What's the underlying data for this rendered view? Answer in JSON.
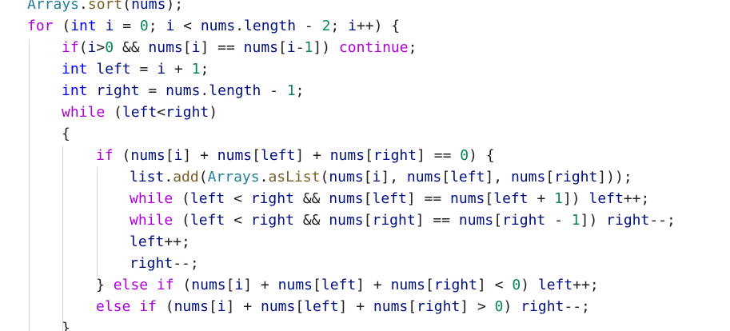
{
  "editor": {
    "lines": [
      "Arrays.sort(nums);",
      "for (int i = 0; i < nums.length - 2; i++) {",
      "if(i>0 && nums[i] == nums[i-1]) continue;",
      "int left = i + 1;",
      "int right = nums.length - 1;",
      "while (left<right)",
      "{",
      "if (nums[i] + nums[left] + nums[right] == 0) {",
      "list.add(Arrays.asList(nums[i], nums[left], nums[right]));",
      "while (left < right && nums[left] == nums[left + 1]) left++;",
      "while (left < right && nums[right] == nums[right - 1]) right--;",
      "left++;",
      "right--;",
      "} else if (nums[i] + nums[left] + nums[right] < 0) left++;",
      "else if (nums[i] + nums[left] + nums[right] > 0) right--;",
      "}"
    ]
  }
}
